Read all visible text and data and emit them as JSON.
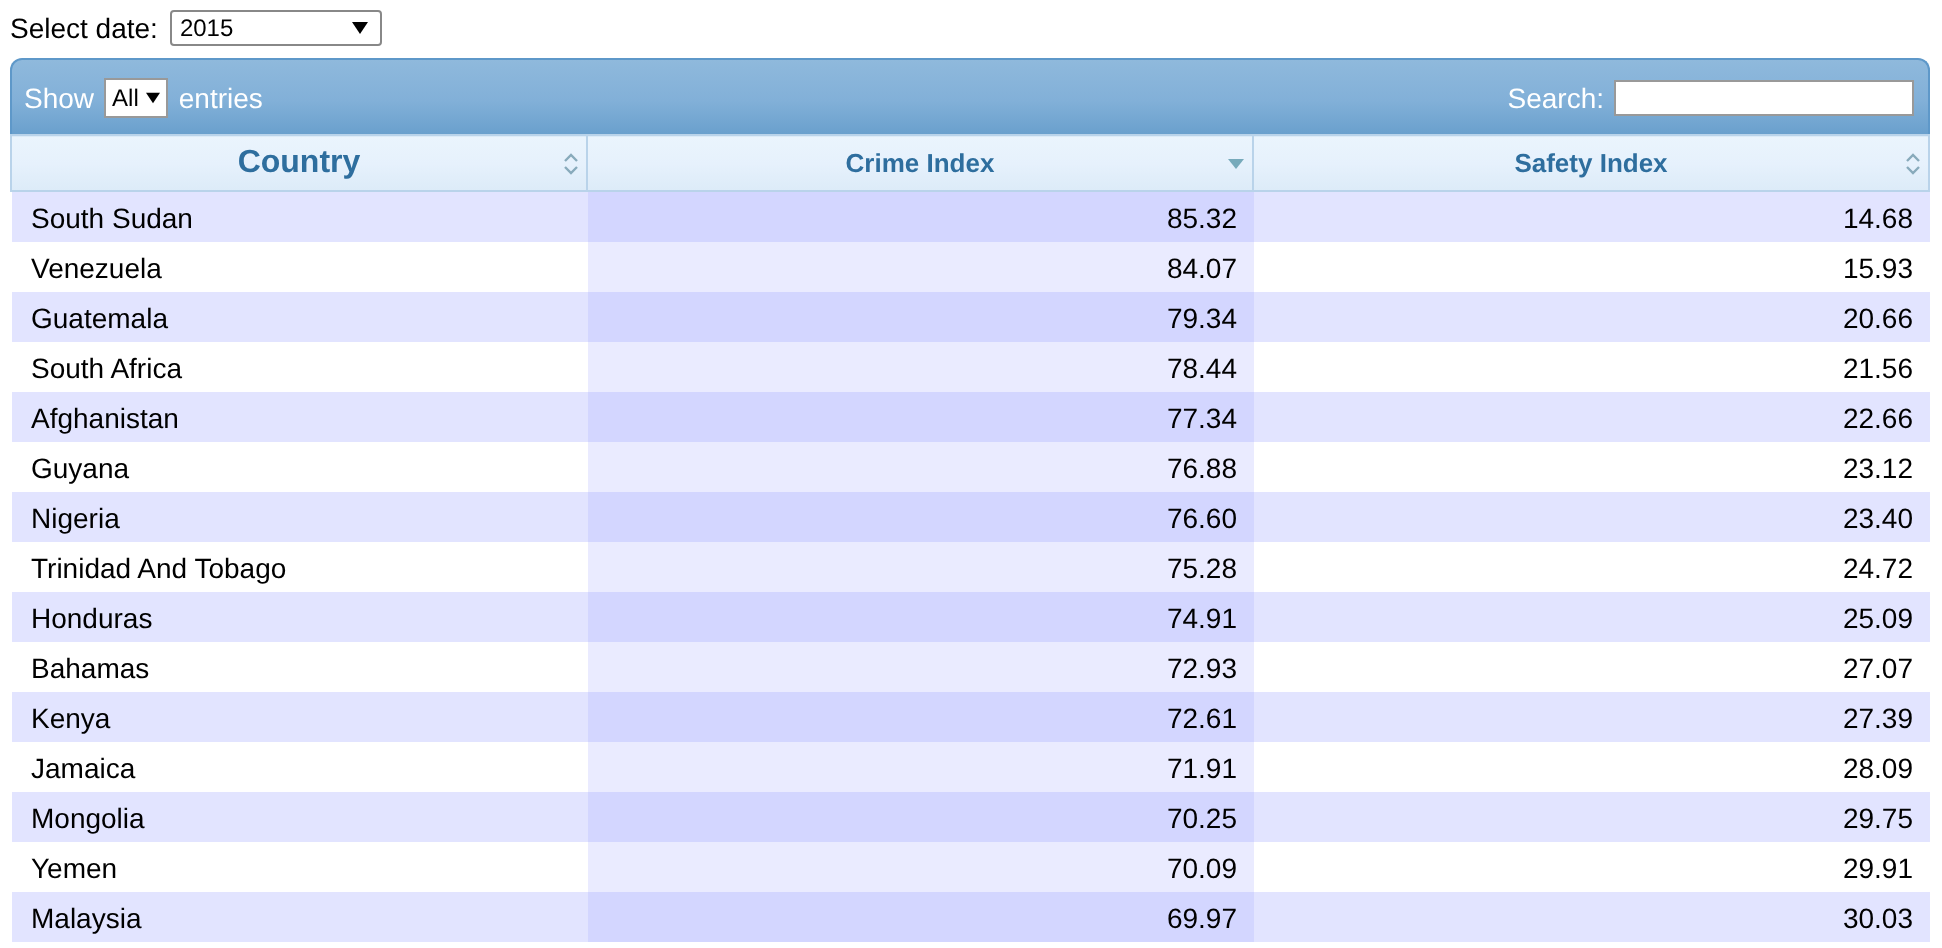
{
  "date_select": {
    "label": "Select date:",
    "value": "2015"
  },
  "length_select": {
    "prefix": "Show",
    "value": "All",
    "suffix": "entries"
  },
  "search": {
    "label": "Search:"
  },
  "table": {
    "columns": [
      {
        "title": "Country",
        "sorted": false
      },
      {
        "title": "Crime Index",
        "sorted": true
      },
      {
        "title": "Safety Index",
        "sorted": false
      }
    ],
    "rows": [
      [
        "South Sudan",
        "85.32",
        "14.68"
      ],
      [
        "Venezuela",
        "84.07",
        "15.93"
      ],
      [
        "Guatemala",
        "79.34",
        "20.66"
      ],
      [
        "South Africa",
        "78.44",
        "21.56"
      ],
      [
        "Afghanistan",
        "77.34",
        "22.66"
      ],
      [
        "Guyana",
        "76.88",
        "23.12"
      ],
      [
        "Nigeria",
        "76.60",
        "23.40"
      ],
      [
        "Trinidad And Tobago",
        "75.28",
        "24.72"
      ],
      [
        "Honduras",
        "74.91",
        "25.09"
      ],
      [
        "Bahamas",
        "72.93",
        "27.07"
      ],
      [
        "Kenya",
        "72.61",
        "27.39"
      ],
      [
        "Jamaica",
        "71.91",
        "28.09"
      ],
      [
        "Mongolia",
        "70.25",
        "29.75"
      ],
      [
        "Yemen",
        "70.09",
        "29.91"
      ],
      [
        "Malaysia",
        "69.97",
        "30.03"
      ]
    ]
  }
}
